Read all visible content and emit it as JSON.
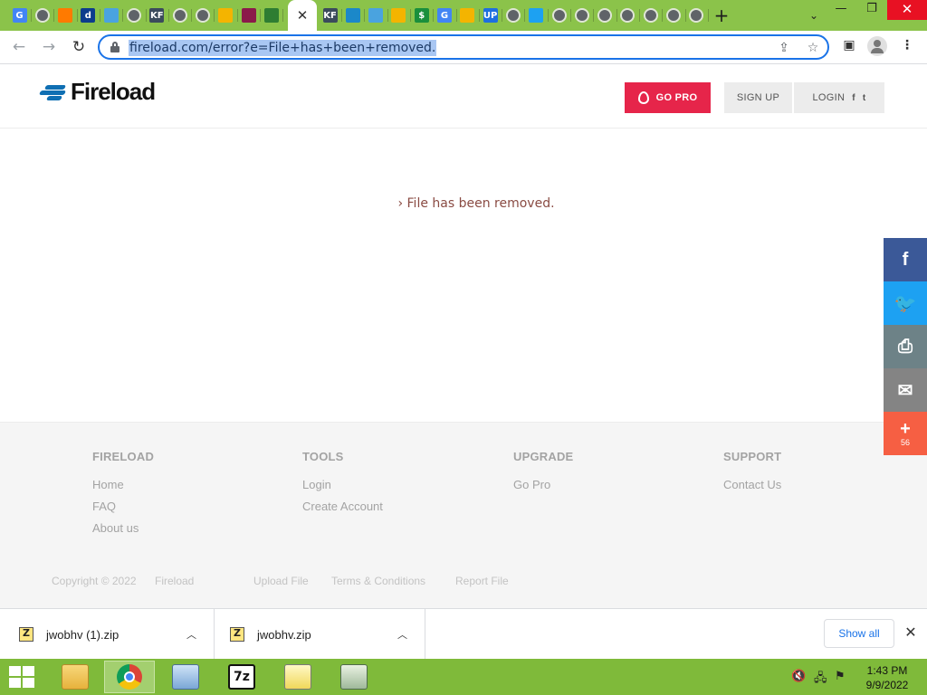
{
  "browser": {
    "tabs": [
      {
        "icon": "google-g-icon",
        "letter": "G",
        "color": "#4285f4"
      },
      {
        "icon": "globe-icon",
        "letter": "",
        "color": "#5f6368"
      },
      {
        "icon": "compass-icon",
        "letter": "",
        "color": "#ff7a00"
      },
      {
        "icon": "d-icon",
        "letter": "d",
        "color": "#0c3c8c"
      },
      {
        "icon": "home-doc-icon",
        "letter": "",
        "color": "#4aa3df"
      },
      {
        "icon": "globe-icon",
        "letter": "",
        "color": "#5f6368"
      },
      {
        "icon": "kf-icon",
        "letter": "KF",
        "color": "#3b4b5c"
      },
      {
        "icon": "globe-icon",
        "letter": "",
        "color": "#5f6368"
      },
      {
        "icon": "globe-icon",
        "letter": "",
        "color": "#5f6368"
      },
      {
        "icon": "folder-icon",
        "letter": "",
        "color": "#f4b400"
      },
      {
        "icon": "chevron-stack-icon",
        "letter": "",
        "color": "#8b1a4a"
      },
      {
        "icon": "rocket-icon",
        "letter": "",
        "color": "#2e7d32"
      },
      {
        "icon": "kf-icon",
        "letter": "KF",
        "color": "#3b4b5c"
      },
      {
        "icon": "fish-icon",
        "letter": "",
        "color": "#1b88c9"
      },
      {
        "icon": "home-doc-icon",
        "letter": "",
        "color": "#4aa3df"
      },
      {
        "icon": "zip-folder-icon",
        "letter": "",
        "color": "#f4b400"
      },
      {
        "icon": "dollar-icon",
        "letter": "$",
        "color": "#1a8f3c"
      },
      {
        "icon": "google-g-icon",
        "letter": "G",
        "color": "#4285f4"
      },
      {
        "icon": "zip-folder-icon",
        "letter": "",
        "color": "#f4b400"
      },
      {
        "icon": "up-icon",
        "letter": "UP",
        "color": "#1d6fe0"
      },
      {
        "icon": "globe-icon",
        "letter": "",
        "color": "#5f6368"
      },
      {
        "icon": "twitter-icon",
        "letter": "",
        "color": "#1da1f2"
      },
      {
        "icon": "globe-icon",
        "letter": "",
        "color": "#5f6368"
      },
      {
        "icon": "globe-icon",
        "letter": "",
        "color": "#5f6368"
      },
      {
        "icon": "globe-icon",
        "letter": "",
        "color": "#5f6368"
      },
      {
        "icon": "globe-icon",
        "letter": "",
        "color": "#5f6368"
      },
      {
        "icon": "globe-icon",
        "letter": "",
        "color": "#5f6368"
      },
      {
        "icon": "globe-icon",
        "letter": "",
        "color": "#5f6368"
      },
      {
        "icon": "globe-icon",
        "letter": "",
        "color": "#5f6368"
      }
    ],
    "active_tab_close": "✕",
    "new_tab": "+",
    "url": "fireload.com/error?e=File+has+been+removed."
  },
  "site": {
    "logo_text": "Fireload",
    "go_pro": "GO PRO",
    "sign_up": "SIGN UP",
    "login": "LOGIN",
    "login_social_f": "f",
    "login_social_t": "t",
    "error_message": "› File has been removed."
  },
  "footer": {
    "columns": [
      {
        "title": "FIRELOAD",
        "links": [
          "Home",
          "FAQ",
          "About us"
        ]
      },
      {
        "title": "TOOLS",
        "links": [
          "Login",
          "Create Account"
        ]
      },
      {
        "title": "UPGRADE",
        "links": [
          "Go Pro"
        ]
      },
      {
        "title": "SUPPORT",
        "links": [
          "Contact Us"
        ]
      }
    ],
    "copyright": "Copyright © 2022",
    "brand": "Fireload",
    "bottom_links": [
      "Upload File",
      "Terms & Conditions",
      "Report File"
    ]
  },
  "share": {
    "facebook": "f",
    "twitter": "t",
    "print": "⎙",
    "email": "✉",
    "more": "+",
    "count": "56",
    "colors": {
      "facebook": "#3b5998",
      "twitter": "#1da1f2",
      "print": "#6d8287",
      "email": "#848484",
      "more": "#f65f43"
    }
  },
  "downloads": {
    "items": [
      {
        "name": "jwobhv (1).zip"
      },
      {
        "name": "jwobhv.zip"
      }
    ],
    "show_all": "Show all"
  },
  "taskbar": {
    "time": "1:43 PM",
    "date": "9/9/2022"
  },
  "colors": {
    "chrome_frame": "#8bc34a",
    "taskbar": "#7fba3a",
    "go_pro": "#e6254a",
    "error_text": "#8a4b43"
  }
}
